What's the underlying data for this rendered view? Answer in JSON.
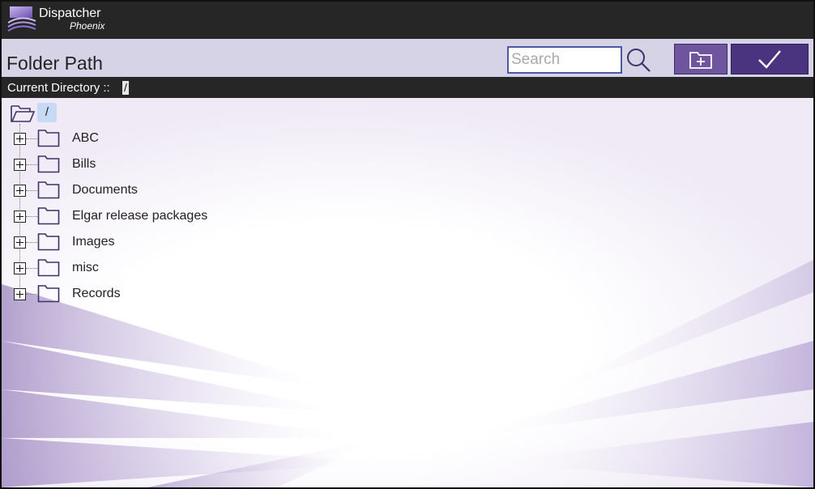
{
  "app": {
    "title": "Dispatcher",
    "subtitle": "Phoenix"
  },
  "header": {
    "title": "Folder Path",
    "search_placeholder": "Search",
    "search_value": ""
  },
  "current_directory": {
    "label": "Current Directory ::",
    "value": "/"
  },
  "tree": {
    "root_label": "/",
    "items": [
      {
        "label": "ABC"
      },
      {
        "label": "Bills"
      },
      {
        "label": "Documents"
      },
      {
        "label": "Elgar release packages"
      },
      {
        "label": "Images"
      },
      {
        "label": "misc"
      },
      {
        "label": "Records"
      }
    ]
  },
  "icons": {
    "logo": "dispatcher-logo-icon",
    "search": "search-icon",
    "new_folder": "folder-plus-icon",
    "confirm": "checkmark-icon",
    "root": "folder-open-icon",
    "folder": "folder-icon",
    "expand": "plus-box-icon"
  },
  "colors": {
    "topbar": "#262626",
    "header_bg": "#d7d3e6",
    "new_folder_button": "#6f559e",
    "confirm_button": "#4a3480",
    "root_highlight": "#c6daf4",
    "icon_stroke": "#3d3166"
  }
}
